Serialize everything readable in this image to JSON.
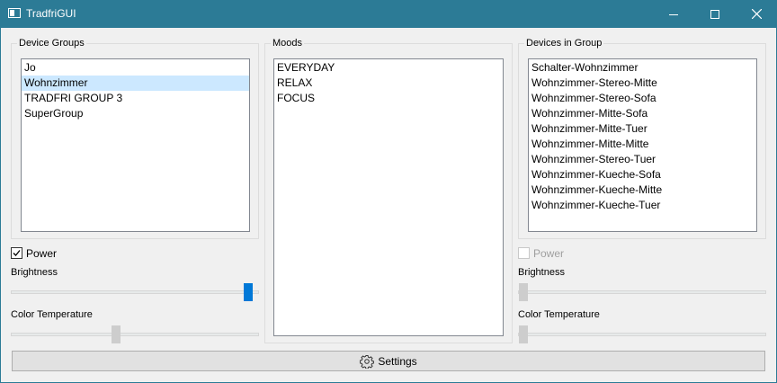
{
  "window": {
    "title": "TradfriGUI",
    "buttons": [
      "minimize",
      "maximize",
      "close"
    ]
  },
  "device_groups": {
    "title": "Device Groups",
    "items": [
      "Jo",
      "Wohnzimmer",
      "TRADFRI GROUP 3",
      "SuperGroup"
    ],
    "selected": "Wohnzimmer"
  },
  "moods": {
    "title": "Moods",
    "items": [
      "EVERYDAY",
      "RELAX",
      "FOCUS"
    ]
  },
  "devices_in_group": {
    "title": "Devices in Group",
    "items": [
      "Schalter-Wohnzimmer",
      "Wohnzimmer-Stereo-Mitte",
      "Wohnzimmer-Stereo-Sofa",
      "Wohnzimmer-Mitte-Sofa",
      "Wohnzimmer-Mitte-Tuer",
      "Wohnzimmer-Mitte-Mitte",
      "Wohnzimmer-Stereo-Tuer",
      "Wohnzimmer-Kueche-Sofa",
      "Wohnzimmer-Kueche-Mitte",
      "Wohnzimmer-Kueche-Tuer"
    ]
  },
  "group_controls": {
    "power_label": "Power",
    "power_checked": true,
    "brightness_label": "Brightness",
    "brightness_value": 1.0,
    "color_temp_label": "Color Temperature",
    "color_temp_value": 0.43
  },
  "device_controls": {
    "power_label": "Power",
    "power_checked": false,
    "enabled": false,
    "brightness_label": "Brightness",
    "brightness_value": 0.0,
    "color_temp_label": "Color Temperature",
    "color_temp_value": 0.0
  },
  "settings_button": {
    "label": "Settings",
    "icon": "gear-icon"
  },
  "colors": {
    "titlebar": "#2c7b96",
    "selection": "#cce8ff",
    "slider_active": "#0078d7"
  }
}
